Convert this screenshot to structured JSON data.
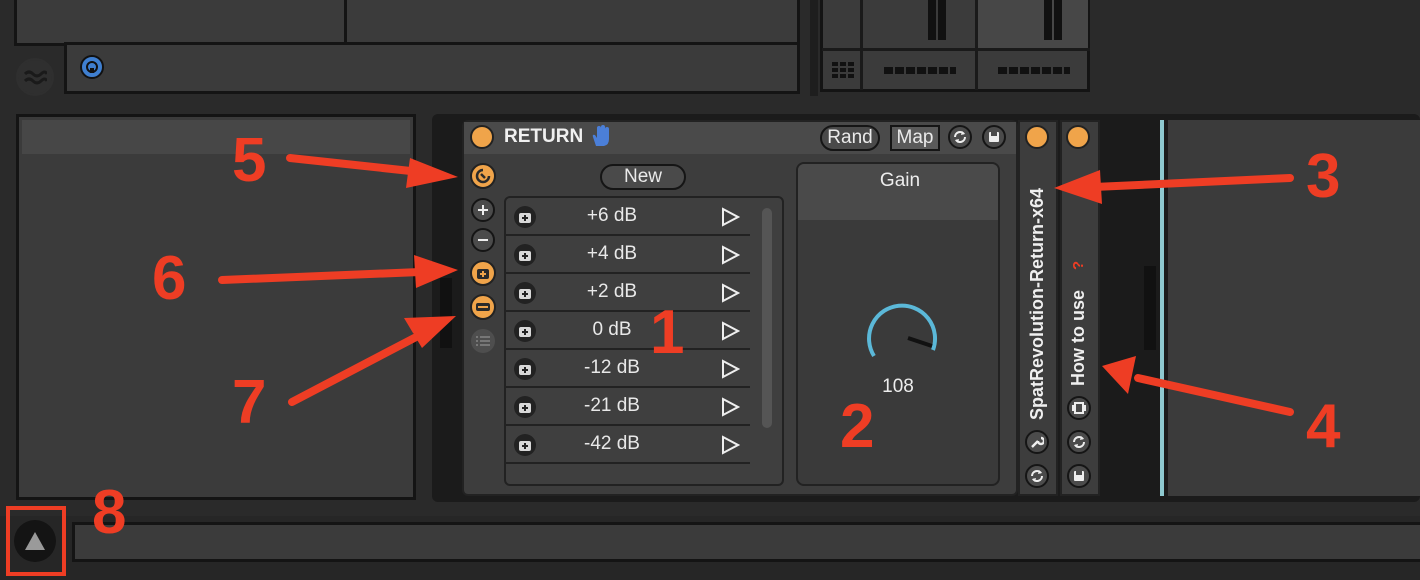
{
  "device": {
    "title": "RETURN",
    "rand_label": "Rand",
    "map_label": "Map",
    "new_label": "New",
    "presets": [
      {
        "label": "+6  dB"
      },
      {
        "label": "+4  dB"
      },
      {
        "label": "+2  dB"
      },
      {
        "label": "0  dB"
      },
      {
        "label": "-12 dB"
      },
      {
        "label": "-21 dB"
      },
      {
        "label": "-42 dB"
      }
    ],
    "gain_label": "Gain",
    "gain_value": "108"
  },
  "plugin": {
    "name": "SpatRevolution-Return-x64"
  },
  "help_device": {
    "label": "How to use",
    "question": "?"
  },
  "annotations": {
    "n1": "1",
    "n2": "2",
    "n3": "3",
    "n4": "4",
    "n5": "5",
    "n6": "6",
    "n7": "7",
    "n8": "8"
  },
  "colors": {
    "accent_orange": "#f0a44a",
    "arrow_red": "#ee3d24",
    "knob_blue": "#5bb8d8"
  }
}
